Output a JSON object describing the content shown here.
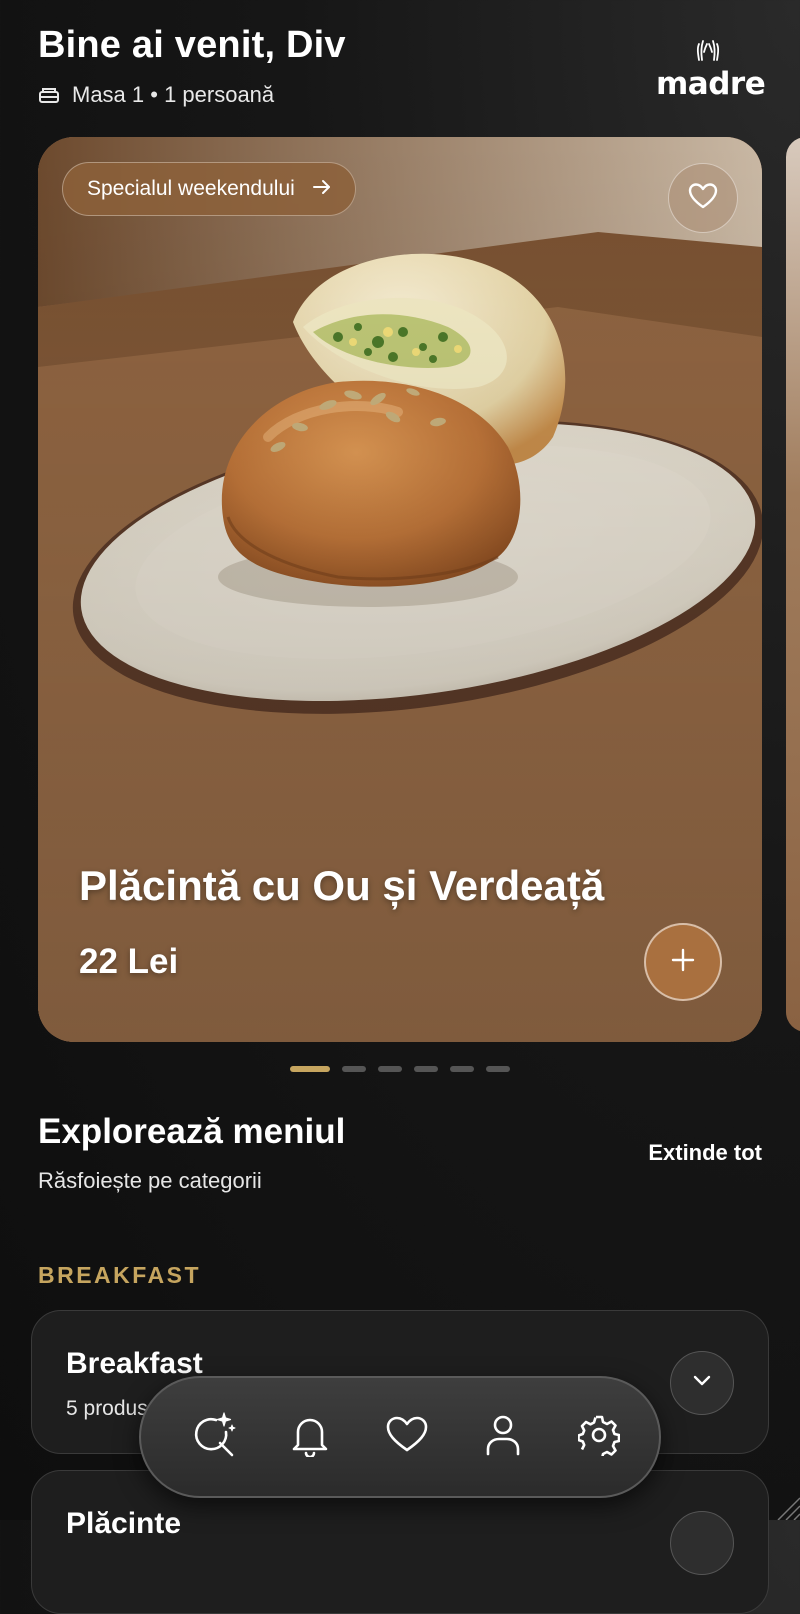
{
  "header": {
    "welcome": "Bine ai venit, Div",
    "table_info": "Masa 1 • 1 persoană"
  },
  "logo": {
    "text": "madre"
  },
  "featured": {
    "badge_label": "Specialul weekendului",
    "product_name": "Plăcintă cu Ou și Verdeață",
    "price": "22 Lei",
    "carousel": {
      "total": 6,
      "active": 0
    }
  },
  "explore": {
    "title": "Explorează meniul",
    "subtitle": "Răsfoiește pe categorii",
    "expand_all": "Extinde tot"
  },
  "sections": [
    {
      "label": "BREAKFAST",
      "categories": [
        {
          "title": "Breakfast",
          "count": "5 produse"
        },
        {
          "title": "Plăcinte",
          "count": ""
        }
      ]
    }
  ],
  "nav": {
    "items": [
      "search-ai-icon",
      "bell-icon",
      "heart-icon",
      "user-icon",
      "gear-icon"
    ]
  },
  "colors": {
    "accent_gold": "#c6a55f",
    "background": "#141414",
    "card_brown": "#8a6242",
    "add_button": "#a9703f"
  }
}
